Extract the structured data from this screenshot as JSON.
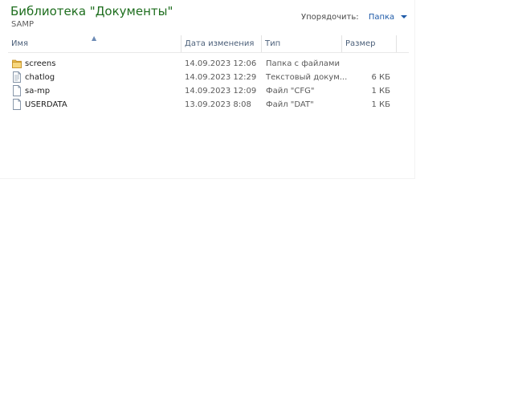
{
  "library": {
    "title": "Библиотека \"Документы\"",
    "subtitle": "SAMP"
  },
  "arrange": {
    "label": "Упорядочить:",
    "value": "Папка"
  },
  "columns": {
    "name": "Имя",
    "date": "Дата изменения",
    "type": "Тип",
    "size": "Размер"
  },
  "files": [
    {
      "name": "screens",
      "date": "14.09.2023 12:06",
      "type": "Папка с файлами",
      "size": "",
      "icon": "folder-icon"
    },
    {
      "name": "chatlog",
      "date": "14.09.2023 12:29",
      "type": "Текстовый докум...",
      "size": "6 КБ",
      "icon": "text-file-icon"
    },
    {
      "name": "sa-mp",
      "date": "14.09.2023 12:09",
      "type": "Файл \"CFG\"",
      "size": "1 КБ",
      "icon": "file-icon"
    },
    {
      "name": "USERDATA",
      "date": "13.09.2023 8:08",
      "type": "Файл \"DAT\"",
      "size": "1 КБ",
      "icon": "file-icon"
    }
  ]
}
